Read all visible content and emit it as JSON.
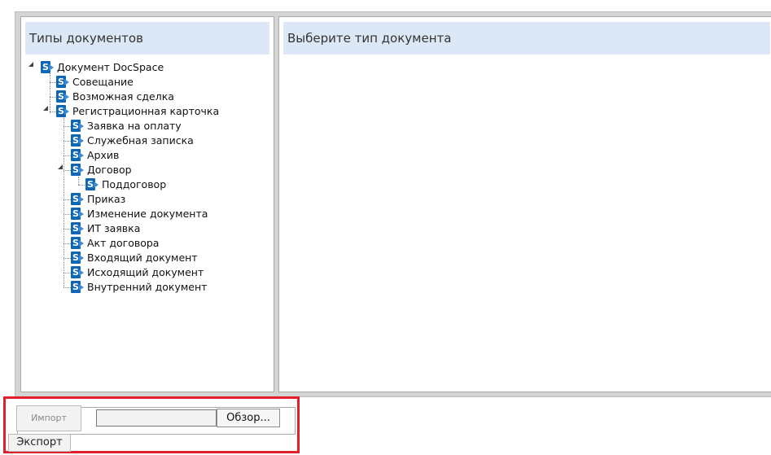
{
  "left_panel": {
    "title": "Типы документов"
  },
  "right_panel": {
    "title": "Выберите тип документа"
  },
  "tree": {
    "root": {
      "label": "Документ DocSpace",
      "expanded": true,
      "icon": "sharepoint-icon"
    },
    "level1": [
      {
        "label": "Совещание"
      },
      {
        "label": "Возможная сделка"
      },
      {
        "label": "Регистрационная карточка",
        "expanded": true
      }
    ],
    "level2": [
      {
        "label": "Заявка на оплату"
      },
      {
        "label": "Служебная записка"
      },
      {
        "label": "Архив"
      },
      {
        "label": "Договор",
        "expanded": true
      },
      {
        "label": "Приказ"
      },
      {
        "label": "Изменение документа"
      },
      {
        "label": "ИТ заявка"
      },
      {
        "label": "Акт договора"
      },
      {
        "label": "Входящий документ"
      },
      {
        "label": "Исходящий документ"
      },
      {
        "label": "Внутренний документ"
      }
    ],
    "level3": [
      {
        "label": "Поддоговор"
      }
    ]
  },
  "bottom": {
    "import_label": "Импорт",
    "file_value": "",
    "browse_label": "Обзор...",
    "export_label": "Экспорт"
  },
  "colors": {
    "header_bg": "#dde8f6",
    "icon_blue": "#0d67b5",
    "highlight_red": "#e0202a",
    "frame_gray": "#d4d4d4"
  }
}
